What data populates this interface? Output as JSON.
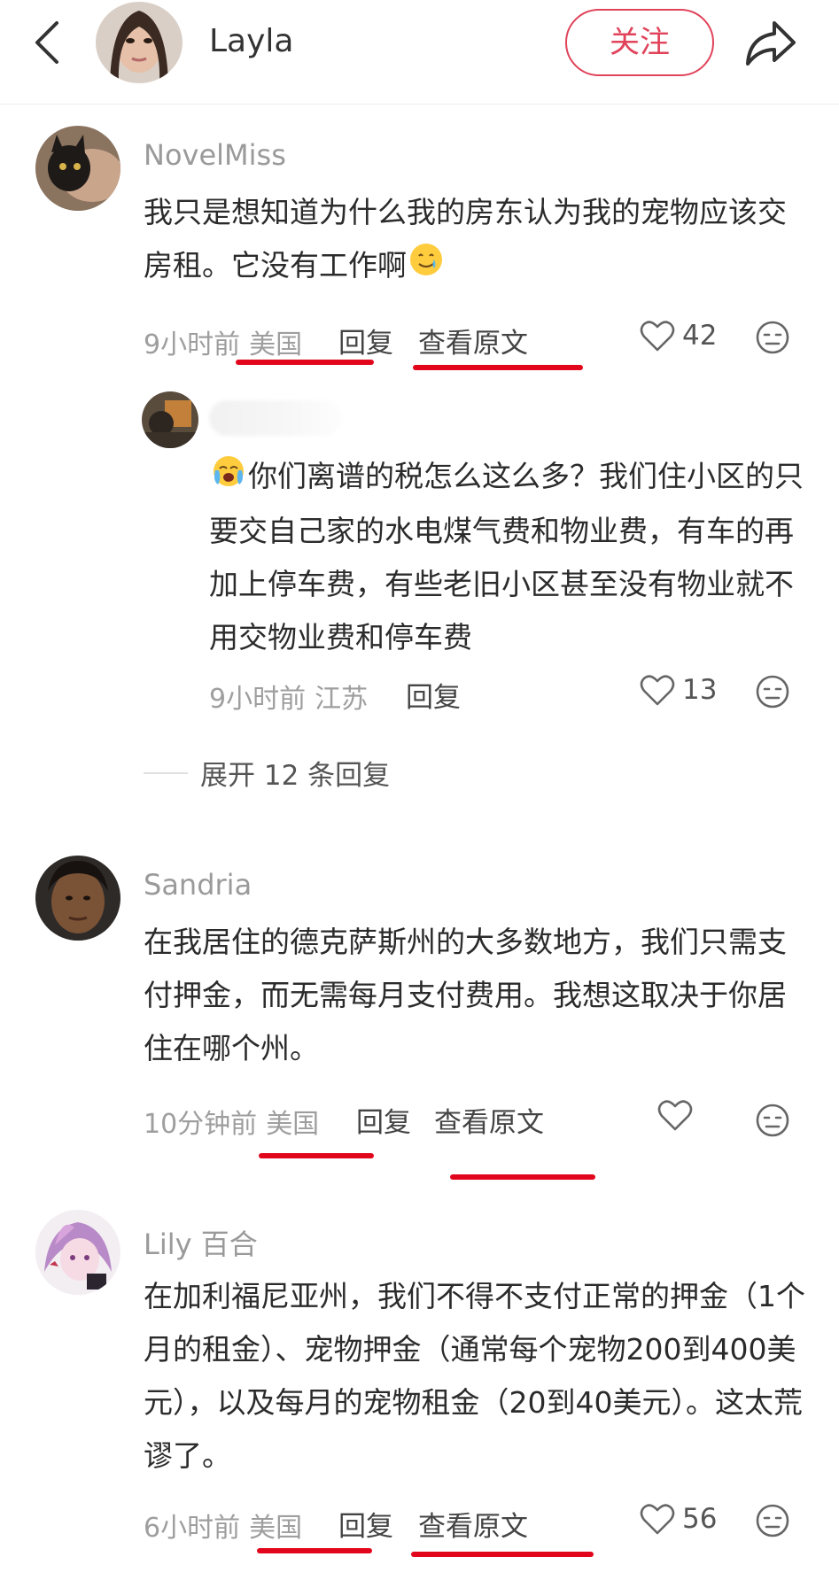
{
  "header": {
    "username": "Layla",
    "follow_label": "关注"
  },
  "comments": [
    {
      "username": "NovelMiss",
      "text": "我只是想知道为什么我的房东认为我的宠物应该交房租。它没有工作啊",
      "emoji": "smiling-tear",
      "time": "9小时前",
      "region": "美国",
      "reply_label": "回复",
      "view_original_label": "查看原文",
      "likes": "42",
      "reply": {
        "text": "你们离谱的税怎么这么多？我们住小区的只要交自己家的水电煤气费和物业费，有车的再加上停车费，有些老旧小区甚至没有物业就不用交物业费和停车费",
        "emoji": "crying-face",
        "time": "9小时前",
        "region": "江苏",
        "reply_label": "回复",
        "likes": "13"
      },
      "expand_label": "展开 12 条回复"
    },
    {
      "username": "Sandria",
      "text": "在我居住的德克萨斯州的大多数地方，我们只需支付押金，而无需每月支付费用。我想这取决于你居住在哪个州。",
      "time": "10分钟前",
      "region": "美国",
      "reply_label": "回复",
      "view_original_label": "查看原文",
      "likes": ""
    },
    {
      "username": "Lily 百合",
      "text": "在加利福尼亚州，我们不得不支付正常的押金（1个月的租金）、宠物押金（通常每个宠物200到400美元），以及每月的宠物租金（20到40美元）。这太荒谬了。",
      "time": "6小时前",
      "region": "美国",
      "reply_label": "回复",
      "view_original_label": "查看原文",
      "likes": "56"
    }
  ],
  "colors": {
    "accent": "#e0435a",
    "annotation_underline": "#e1061b"
  }
}
